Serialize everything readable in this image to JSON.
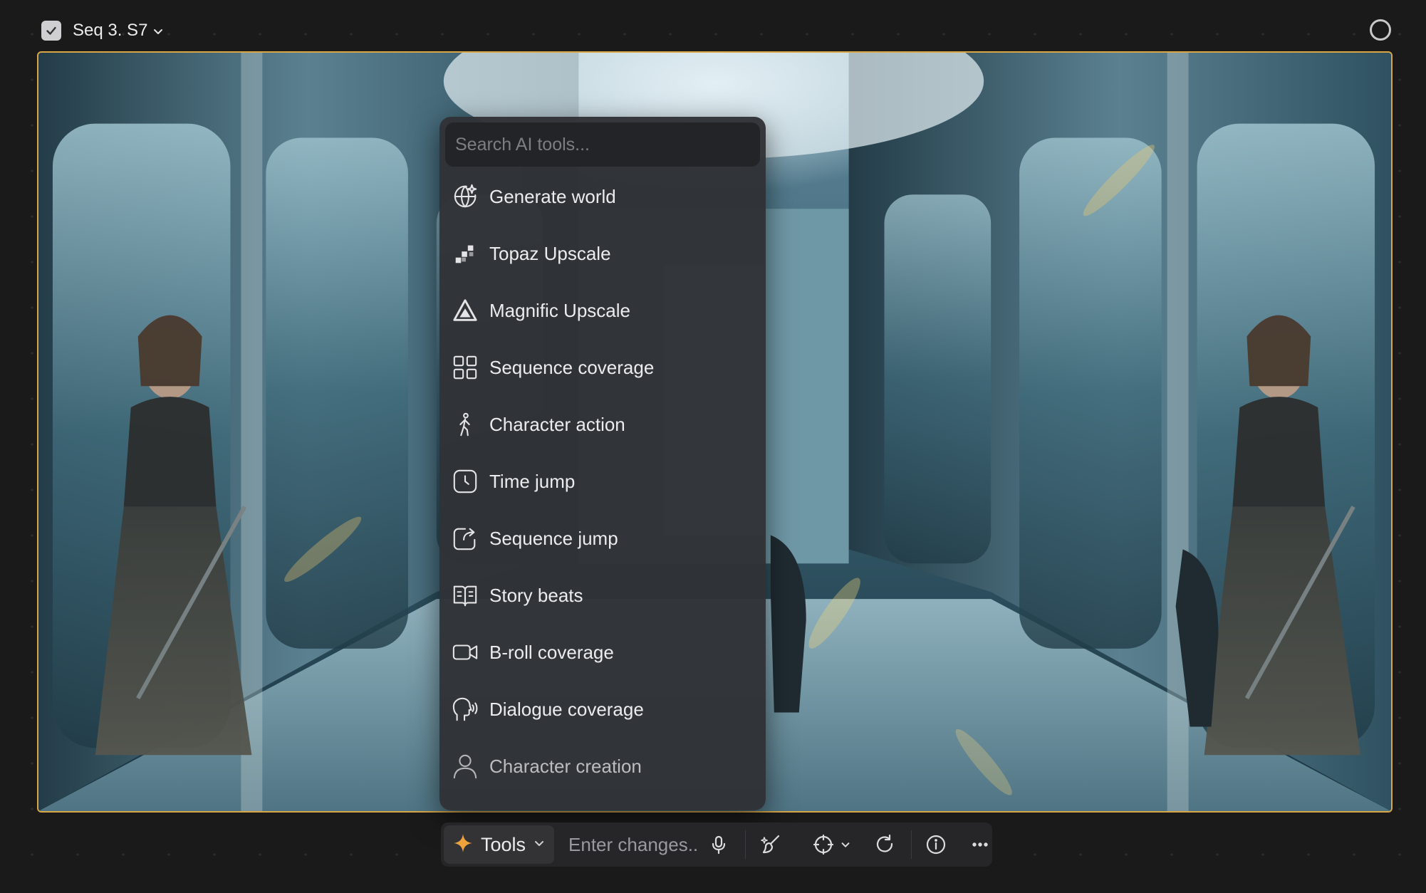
{
  "header": {
    "checkbox_checked": true,
    "title": "Seq 3. S7",
    "icons": [
      "check-icon",
      "chevron-down-icon",
      "circle-icon"
    ]
  },
  "colors": {
    "selection_border": "#d9a646",
    "menu_bg": "#303236",
    "toolbar_bg": "#262629",
    "accent_star": "#f0a33c"
  },
  "menu": {
    "search_placeholder": "Search AI tools...",
    "items": [
      {
        "label": "Generate world",
        "icon": "globe-sparkle-icon"
      },
      {
        "label": "Topaz Upscale",
        "icon": "topaz-upscale-icon"
      },
      {
        "label": "Magnific Upscale",
        "icon": "triangle-icon"
      },
      {
        "label": "Sequence coverage",
        "icon": "grid-icon"
      },
      {
        "label": "Character action",
        "icon": "walking-figure-icon"
      },
      {
        "label": "Time jump",
        "icon": "clock-icon"
      },
      {
        "label": "Sequence jump",
        "icon": "share-arrow-icon"
      },
      {
        "label": "Story beats",
        "icon": "open-book-icon"
      },
      {
        "label": "B-roll coverage",
        "icon": "video-camera-icon"
      },
      {
        "label": "Dialogue coverage",
        "icon": "speaking-head-icon"
      },
      {
        "label": "Character creation",
        "icon": "user-icon"
      }
    ]
  },
  "toolbar": {
    "tools_label": "Tools",
    "input_placeholder": "Enter changes...",
    "icons": [
      "sparkle-icon",
      "chevron-down-icon",
      "microphone-icon",
      "brush-icon",
      "crosshair-icon",
      "chevron-down-icon",
      "refresh-icon",
      "info-icon",
      "more-icon"
    ]
  }
}
